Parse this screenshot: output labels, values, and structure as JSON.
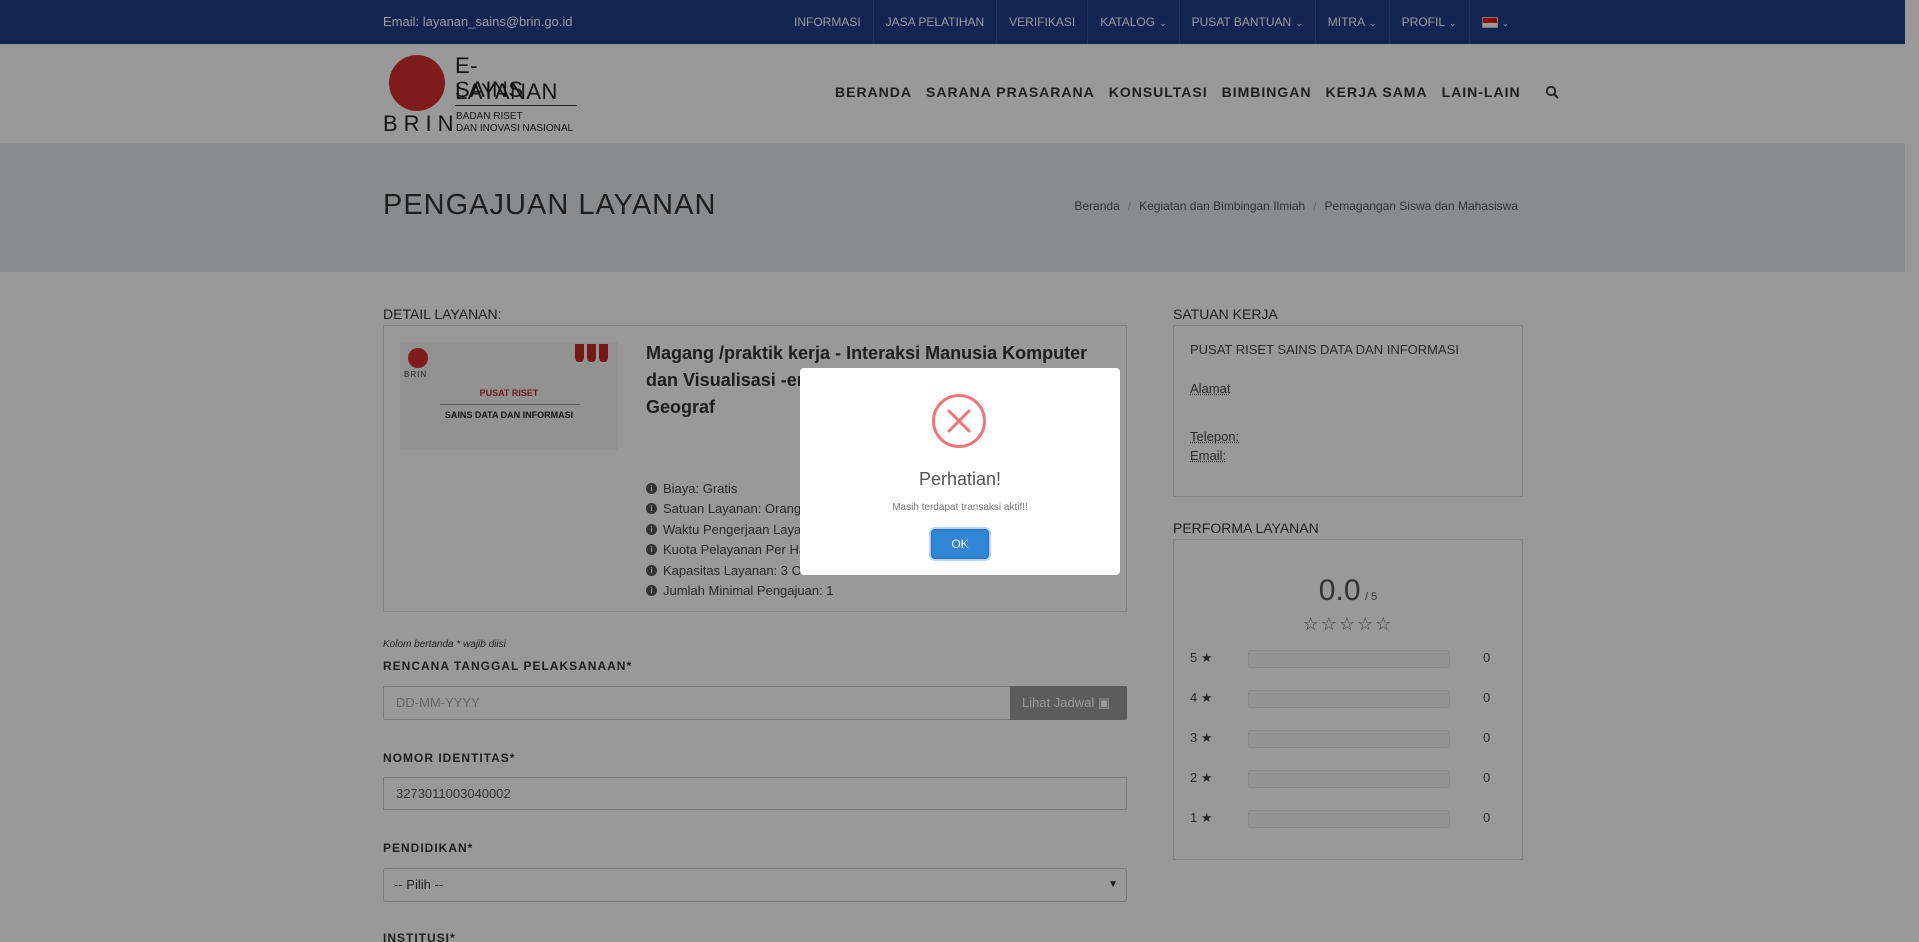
{
  "topbar": {
    "email": "Email: layanan_sains@brin.go.id",
    "menu": [
      {
        "label": "INFORMASI",
        "dropdown": false
      },
      {
        "label": "JASA PELATIHAN",
        "dropdown": false
      },
      {
        "label": "VERIFIKASI",
        "dropdown": false
      },
      {
        "label": "KATALOG",
        "dropdown": true
      },
      {
        "label": "PUSAT BANTUAN",
        "dropdown": true
      },
      {
        "label": "MITRA",
        "dropdown": true
      },
      {
        "label": "PROFIL",
        "dropdown": true
      }
    ],
    "language_flag": "flag-icon"
  },
  "logo": {
    "line1": "E-LAYANAN",
    "line2": "SAINS",
    "brin": "BRIN",
    "sub1": "BADAN RISET",
    "sub2": "DAN INOVASI NASIONAL"
  },
  "nav": [
    "BERANDA",
    "SARANA PRASARANA",
    "KONSULTASI",
    "BIMBINGAN",
    "KERJA SAMA",
    "LAIN-LAIN"
  ],
  "page": {
    "title": "PENGAJUAN LAYANAN",
    "breadcrumbs": [
      "Beranda",
      "Kegiatan dan Bimbingan Ilmiah",
      "Pemagangan Siswa dan Mahasiswa"
    ]
  },
  "detail": {
    "section_label": "DETAIL LAYANAN:",
    "thumb_line1": "PUSAT RISET",
    "thumb_line2": "SAINS DATA DAN INFORMASI",
    "thumb_brin": "BRIN",
    "title": "Magang /praktik kerja - Interaksi Manusia Komputer dan Visualisasi -er Lembang dan Ses Informasi Geograf",
    "info": [
      "Biaya: Gratis",
      "Satuan Layanan: Orang",
      "Waktu Pengerjaan Laya",
      "Kuota Pelayanan Per Ha",
      "Kapasitas Layanan: 3 O",
      "Jumlah Minimal Pengajuan: 1"
    ]
  },
  "form": {
    "note": "Kolom bertanda * wajib diisi",
    "date_label": "RENCANA TANGGAL PELAKSANAAN*",
    "date_placeholder": "DD-MM-YYYY",
    "schedule_button": "Lihat Jadwal",
    "id_label": "NOMOR IDENTITAS*",
    "id_value": "3273011003040002",
    "education_label": "PENDIDIKAN*",
    "education_value": "-- Pilih --",
    "institution_label": "INSTITUSI*"
  },
  "satuan": {
    "section_label": "SATUAN KERJA",
    "unit": "PUSAT RISET SAINS DATA DAN INFORMASI",
    "alamat": "Alamat",
    "telepon": "Telepon:",
    "email": "Email:"
  },
  "performa": {
    "section_label": "PERFORMA LAYANAN",
    "score": "0.0",
    "max": "/ 5",
    "rows": [
      {
        "stars": "5",
        "count": "0",
        "fill": 0
      },
      {
        "stars": "4",
        "count": "0",
        "fill": 0
      },
      {
        "stars": "3",
        "count": "0",
        "fill": 0
      },
      {
        "stars": "2",
        "count": "0",
        "fill": 0
      },
      {
        "stars": "1",
        "count": "0",
        "fill": 0
      }
    ]
  },
  "modal": {
    "title": "Perhatian!",
    "message": "Masih terdapat transaksi aktif!!",
    "ok_label": "OK",
    "icon": "error-x-icon",
    "error_color": "#f27474",
    "button_color": "#3085d6"
  }
}
